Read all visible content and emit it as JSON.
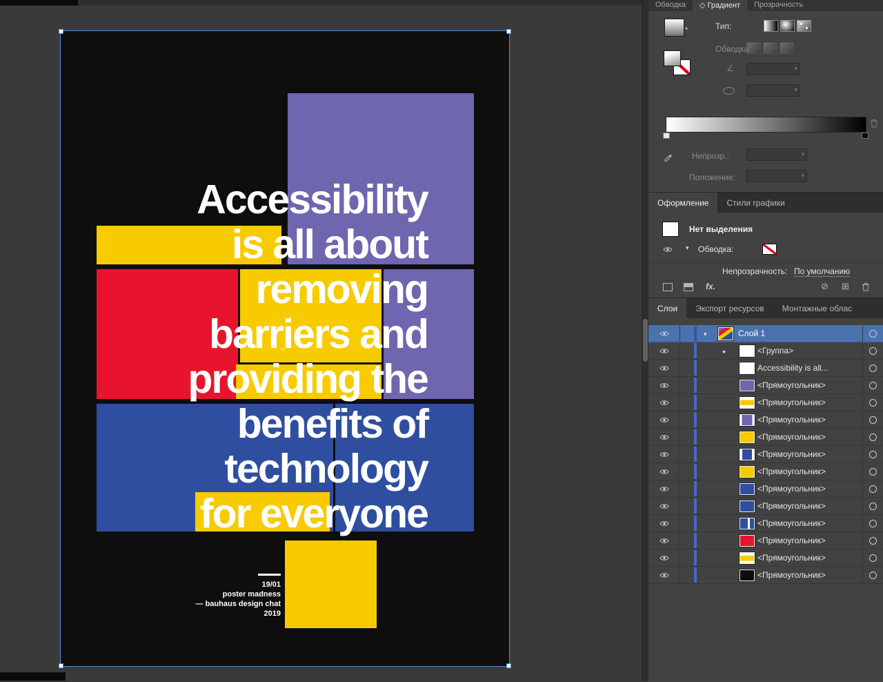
{
  "icons": {
    "chevron_down": "▾",
    "chevron_right": "▸",
    "diamond": "◇",
    "angle": "∠",
    "circle_slash": "⊘",
    "new_item": "⊞",
    "cross": "✕"
  },
  "poster": {
    "headline": [
      "Accessibility",
      "is all about",
      "removing",
      "barriers and",
      "providing the",
      "benefits of",
      "technology",
      "for everyone"
    ],
    "credits": [
      "19/01",
      "poster madness",
      "— bauhaus design chat",
      "2019"
    ],
    "colors": {
      "background": "#0e0e0e",
      "purple": "#6e66ae",
      "yellow": "#f7cb00",
      "red": "#e8142d",
      "blue": "#2f4ea0",
      "white": "#ffffff"
    }
  },
  "gradient_panel": {
    "tabs": {
      "stroke": "Обводка",
      "gradient": "Градиент",
      "transparency": "Прозрачность"
    },
    "type_label": "Тип:",
    "stroke_label": "Обводка:",
    "opacity_label": "Непрозр.:",
    "location_label": "Положение:",
    "slider_colors": [
      "#ffffff",
      "#000000"
    ]
  },
  "appearance_panel": {
    "tab_appearance": "Оформление",
    "tab_graphic_styles": "Стили графики",
    "no_selection": "Нет выделения",
    "stroke_label": "Обводка:",
    "opacity_label": "Непрозрачность:",
    "opacity_value": "По умолчанию",
    "fx_label": "fx."
  },
  "layers_panel": {
    "tab_layers": "Слои",
    "tab_asset_export": "Экспорт ресурсов",
    "tab_artboards": "Монтажные облас",
    "selection_color": "#4a72ae",
    "layer_color": "#4b66c7",
    "rows": [
      {
        "name": "Слой 1",
        "selected": true,
        "thumb": "linear-gradient(145deg,#6e66ae 20%,#e8142d 20% 40%,#f7cb00 40% 60%,#2f4ea0 60%)"
      },
      {
        "name": "<Группа>",
        "thumb": "#ffffff"
      },
      {
        "name": "Accessibility is all...",
        "thumb": "#ffffff"
      },
      {
        "name": "<Прямоугольник>",
        "thumb": "#6e66ae"
      },
      {
        "name": "<Прямоугольник>",
        "thumb": "linear-gradient(180deg,#ffffff 22%,#f7cb00 22% 72%,#ffffff 72%)"
      },
      {
        "name": "<Прямоугольник>",
        "thumb": "linear-gradient(90deg,#ffffff 12%,#6e66ae 12% 88%,#ffffff 88%)"
      },
      {
        "name": "<Прямоугольник>",
        "thumb": "#f7cb00"
      },
      {
        "name": "<Прямоугольник>",
        "thumb": "linear-gradient(90deg,#ffffff 14%,#2f4ea0 14% 86%,#ffffff 86%)"
      },
      {
        "name": "<Прямоугольник>",
        "thumb": "#f7cb00"
      },
      {
        "name": "<Прямоугольник>",
        "thumb": "#2f4ea0"
      },
      {
        "name": "<Прямоугольник>",
        "thumb": "#2f4ea0"
      },
      {
        "name": "<Прямоугольник>",
        "thumb": "linear-gradient(90deg,#2f4ea0 55%,#ffffff 55% 70%,#2f4ea0 70%)"
      },
      {
        "name": "<Прямоугольник>",
        "thumb": "#e8142d"
      },
      {
        "name": "<Прямоугольник>",
        "thumb": "linear-gradient(180deg,#ffffff 28%,#f7cb00 28% 76%,#ffffff 76%)"
      },
      {
        "name": "<Прямоугольник>",
        "thumb": "#0d0d0d"
      }
    ]
  }
}
